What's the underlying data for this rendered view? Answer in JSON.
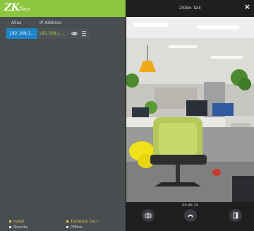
{
  "brand": {
    "logo_main": "ZK",
    "logo_sub": "Teco"
  },
  "device_list": {
    "headers": {
      "alias": "Alias",
      "ip": "IP Address"
    },
    "rows": [
      {
        "alias": "192.168.1...",
        "ip": "192.168.1...",
        "icons": [
          "eye-icon",
          "menu-icon"
        ]
      }
    ]
  },
  "legend": {
    "install": "Install",
    "standby": "Standby",
    "incoming": "Incoming Call",
    "other": "Offline"
  },
  "call_window": {
    "title": "ZKBio Talk",
    "close_label": "×",
    "timer": "00:46:29",
    "controls": [
      "camera-icon",
      "hang-up-icon",
      "door-open-icon"
    ]
  },
  "colors": {
    "brand_green": "#8cc63f",
    "selected_blue": "#1d84c8",
    "ip_green": "#9ed24a",
    "legend_yellow": "#e9d24a"
  }
}
